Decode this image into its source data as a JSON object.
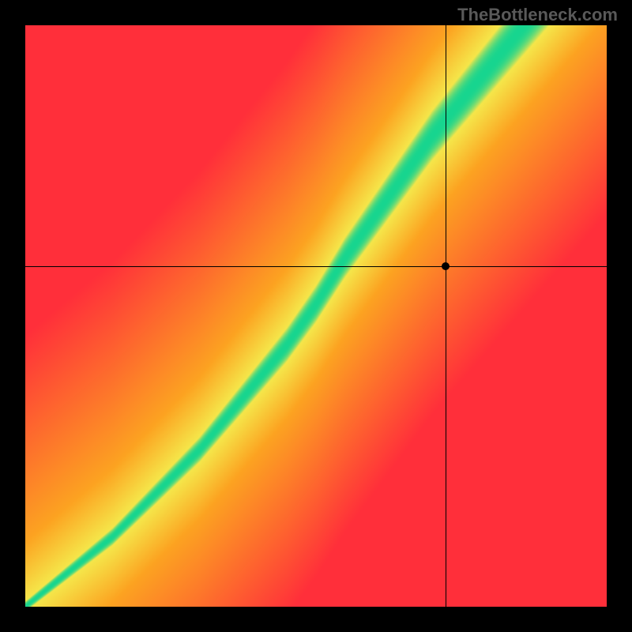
{
  "watermark": "TheBottleneck.com",
  "chart_data": {
    "type": "heatmap",
    "title": "",
    "xlabel": "",
    "ylabel": "",
    "xlim": [
      0,
      1
    ],
    "ylim": [
      0,
      1
    ],
    "crosshair": {
      "x": 0.723,
      "y": 0.585
    },
    "marker": {
      "x": 0.723,
      "y": 0.585
    },
    "ridge_points": [
      {
        "x": 0.0,
        "y": 0.0
      },
      {
        "x": 0.05,
        "y": 0.04
      },
      {
        "x": 0.1,
        "y": 0.08
      },
      {
        "x": 0.15,
        "y": 0.12
      },
      {
        "x": 0.2,
        "y": 0.17
      },
      {
        "x": 0.25,
        "y": 0.22
      },
      {
        "x": 0.3,
        "y": 0.27
      },
      {
        "x": 0.35,
        "y": 0.33
      },
      {
        "x": 0.4,
        "y": 0.39
      },
      {
        "x": 0.45,
        "y": 0.45
      },
      {
        "x": 0.5,
        "y": 0.52
      },
      {
        "x": 0.55,
        "y": 0.6
      },
      {
        "x": 0.6,
        "y": 0.67
      },
      {
        "x": 0.65,
        "y": 0.74
      },
      {
        "x": 0.7,
        "y": 0.81
      },
      {
        "x": 0.75,
        "y": 0.87
      },
      {
        "x": 0.8,
        "y": 0.93
      },
      {
        "x": 0.85,
        "y": 0.99
      }
    ],
    "ridge_width": 0.035,
    "colors": {
      "best": "#17d58f",
      "good": "#f5e64a",
      "mid": "#fca321",
      "bad": "#ff2f3a"
    }
  }
}
